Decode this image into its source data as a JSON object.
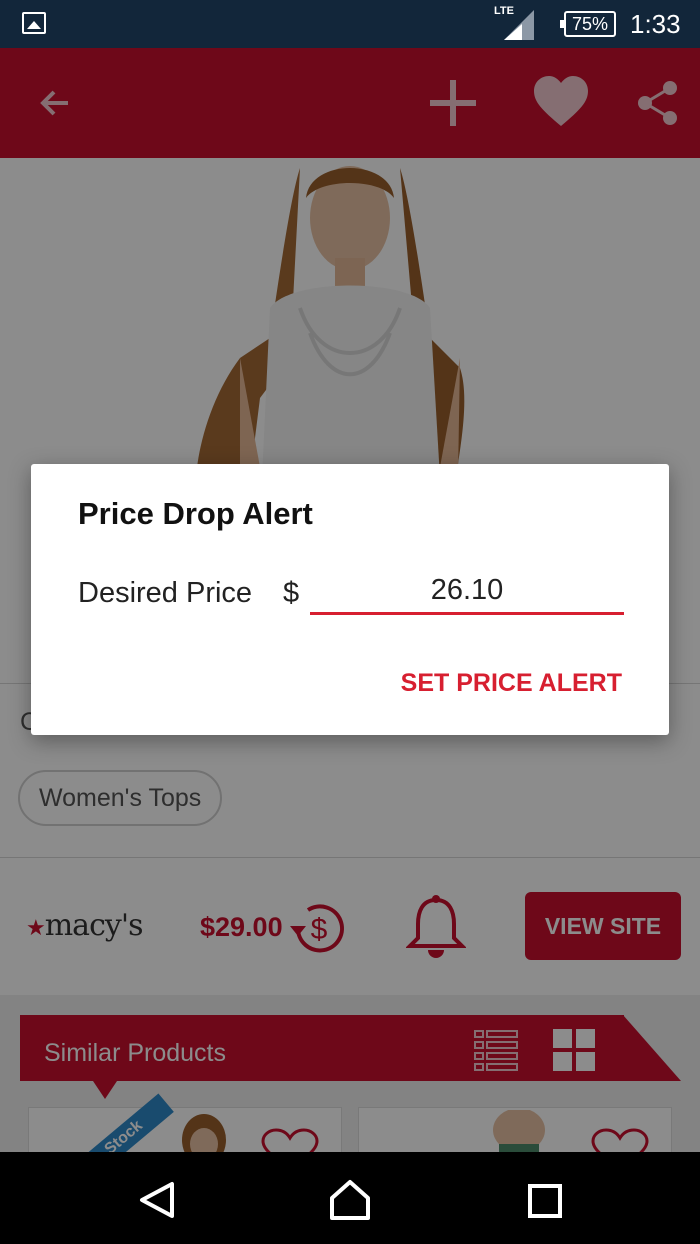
{
  "status_bar": {
    "network": "LTE",
    "battery": "75%",
    "time": "1:33"
  },
  "app_bar": {
    "icons": [
      "back-arrow-icon",
      "add-icon",
      "heart-icon",
      "share-icon"
    ]
  },
  "product": {
    "behind_text": "C",
    "category_chip": "Women's Tops",
    "store_logo": "macy's",
    "price": "$29.00",
    "view_site_label": "VIEW SITE"
  },
  "similar_products": {
    "title": "Similar Products",
    "ribbon": "Stock"
  },
  "dialog": {
    "title": "Price Drop Alert",
    "desired_price_label": "Desired Price",
    "currency_symbol": "$",
    "desired_price_value": "26.10",
    "action_label": "SET PRICE ALERT"
  },
  "colors": {
    "accent": "#c8102e",
    "status_bar": "#12263a",
    "input_underline": "#d71f30",
    "ribbon": "#2f89c8"
  }
}
